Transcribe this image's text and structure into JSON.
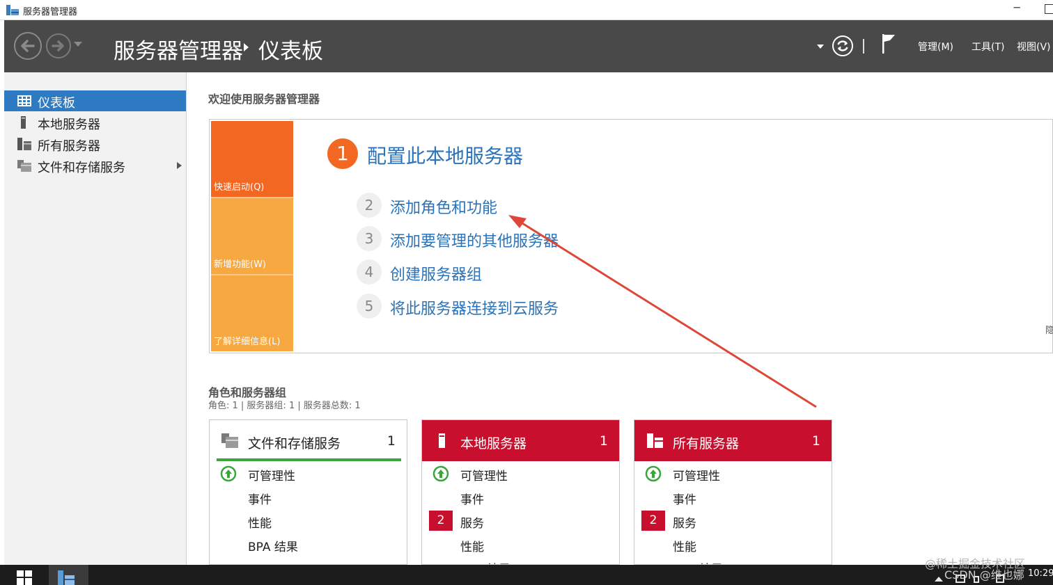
{
  "window": {
    "title": "服务器管理器",
    "minimize_glyph": "─"
  },
  "header": {
    "breadcrumb_root": "服务器管理器",
    "breadcrumb_current": "仪表板",
    "menus": [
      "管理(M)",
      "工具(T)",
      "视图(V)"
    ]
  },
  "sidebar": {
    "items": [
      {
        "label": "仪表板",
        "icon": "dashboard-icon",
        "active": true
      },
      {
        "label": "本地服务器",
        "icon": "server-icon",
        "active": false
      },
      {
        "label": "所有服务器",
        "icon": "servers-icon",
        "active": false
      },
      {
        "label": "文件和存储服务",
        "icon": "file-storage-icon",
        "active": false,
        "has_submenu": true
      }
    ]
  },
  "welcome": {
    "title": "欢迎使用服务器管理器",
    "tiles": [
      "快速启动(Q)",
      "新增功能(W)",
      "了解详细信息(L)"
    ],
    "main_step": {
      "number": "1",
      "label": "配置此本地服务器"
    },
    "steps": [
      {
        "number": "2",
        "label": "添加角色和功能"
      },
      {
        "number": "3",
        "label": "添加要管理的其他服务器"
      },
      {
        "number": "4",
        "label": "创建服务器组"
      },
      {
        "number": "5",
        "label": "将此服务器连接到云服务"
      }
    ],
    "hide_label": "隐"
  },
  "roles": {
    "title": "角色和服务器组",
    "summary": "角色: 1 | 服务器组: 1 | 服务器总数: 1",
    "cards": [
      {
        "title": "文件和存储服务",
        "count": "1",
        "status": "ok",
        "rows": [
          "可管理性",
          "事件",
          "性能",
          "BPA 结果"
        ],
        "badges": [
          "",
          "",
          "",
          ""
        ]
      },
      {
        "title": "本地服务器",
        "count": "1",
        "status": "alert",
        "rows": [
          "可管理性",
          "事件",
          "服务",
          "性能",
          "BPA 结果"
        ],
        "badges": [
          "",
          "",
          "2",
          "",
          ""
        ]
      },
      {
        "title": "所有服务器",
        "count": "1",
        "status": "alert",
        "rows": [
          "可管理性",
          "事件",
          "服务",
          "性能",
          "BPA 结果"
        ],
        "badges": [
          "",
          "",
          "2",
          "",
          ""
        ]
      }
    ]
  },
  "taskbar": {
    "clock": "10:29"
  },
  "watermarks": [
    "@稀土掘金技术社区",
    "CSDN @维也娜"
  ],
  "colors": {
    "header_bg": "#494949",
    "accent_blue": "#2e7bc4",
    "link_blue": "#2a72b9",
    "tile_orange": "#f26722",
    "tile_light_orange": "#f7a841",
    "alert_red": "#c8102e",
    "ok_green": "#3aa63a",
    "annotation_red": "#e0453a"
  }
}
